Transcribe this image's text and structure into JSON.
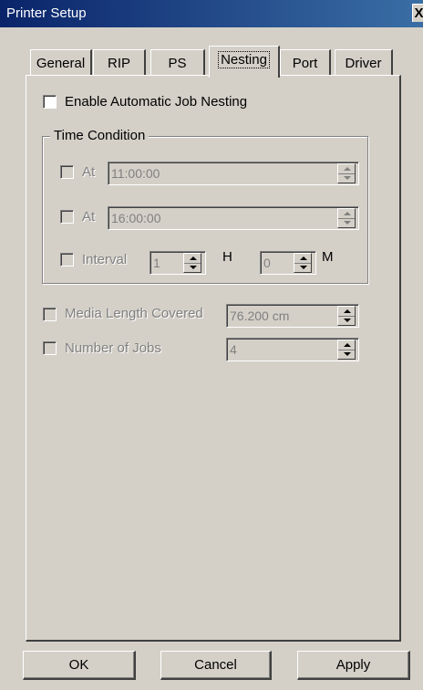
{
  "window": {
    "title": "Printer Setup",
    "close_glyph": "X"
  },
  "tabs": [
    {
      "label": "General"
    },
    {
      "label": "RIP"
    },
    {
      "label": "PS"
    },
    {
      "label": "Nesting"
    },
    {
      "label": "Port"
    },
    {
      "label": "Driver"
    }
  ],
  "nesting": {
    "enable_label": "Enable Automatic Job Nesting",
    "enable_checked": false,
    "time_condition": {
      "title": "Time Condition",
      "at1_label": "At",
      "at1_value": "11:00:00",
      "at2_label": "At",
      "at2_value": "16:00:00",
      "interval_label": "Interval",
      "interval_hours": "1",
      "hours_unit": "H",
      "interval_minutes": "0",
      "minutes_unit": "M"
    },
    "media_label": "Media Length Covered",
    "media_value": "76.200 cm",
    "jobs_label": "Number of Jobs",
    "jobs_value": "4"
  },
  "buttons": {
    "ok": "OK",
    "cancel": "Cancel",
    "apply": "Apply"
  }
}
